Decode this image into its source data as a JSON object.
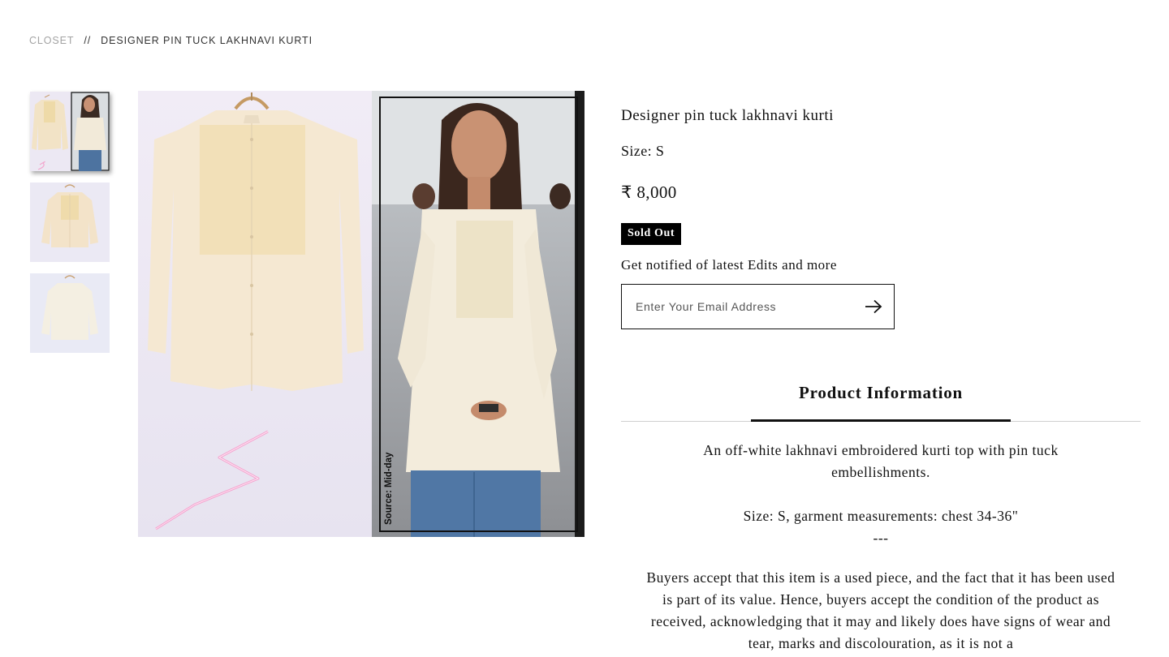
{
  "breadcrumb": {
    "home": "CLOSET",
    "separator": "//",
    "current": "DESIGNER PIN TUCK LAKHNAVI KURTI"
  },
  "gallery": {
    "thumbnails": [
      {
        "name": "thumb-product-and-model",
        "active": true
      },
      {
        "name": "thumb-kurti-front",
        "active": false
      },
      {
        "name": "thumb-kurti-back",
        "active": false
      }
    ],
    "main_image_caption": "Source: Mid-day"
  },
  "product": {
    "title": "Designer pin tuck lakhnavi kurti",
    "size": "Size: S",
    "price": "₹ 8,000",
    "status": "Sold Out"
  },
  "notify": {
    "label": "Get notified of latest Edits and more",
    "placeholder": "Enter Your Email Address",
    "submit_icon": "arrow-right-icon"
  },
  "tabs": [
    {
      "label": "Product Information",
      "active": true
    }
  ],
  "description": {
    "p1": "An off-white lakhnavi embroidered kurti top with pin tuck embellishments.",
    "p2": "Size: S, garment measurements: chest 34-36\"",
    "p2_divider": "---",
    "p3": "Buyers accept that this item is a used piece, and the fact that it has been used is part of its value. Hence, buyers accept the condition of the product as received, acknowledging that it may and likely does have signs of wear and tear, marks and discolouration, as it is not a"
  },
  "colors": {
    "accent": "#000000",
    "muted_text": "#a3a3a3",
    "image_background": "#ece8f3",
    "garment": "#f3e6cf"
  }
}
